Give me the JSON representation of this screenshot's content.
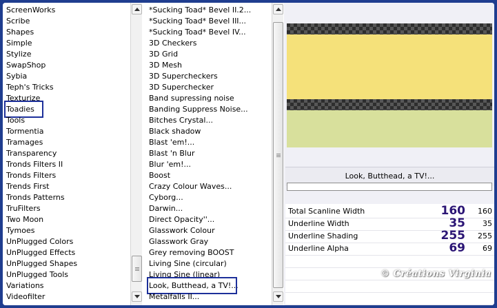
{
  "categories": {
    "items": [
      "ScreenWorks",
      "Scribe",
      "Shapes",
      "Simple",
      "Stylize",
      "SwapShop",
      "Sybia",
      "Teph's Tricks",
      "Texturize",
      "Toadies",
      "Tools",
      "Tormentia",
      "Tramages",
      "Transparency",
      "Tronds Filters II",
      "Tronds Filters",
      "Trends First",
      "Tronds Patterns",
      "TruFilters",
      "Two Moon",
      "Tymoes",
      "UnPlugged Colors",
      "UnPlugged Effects",
      "UnPlugged Shapes",
      "UnPlugged Tools",
      "Variations",
      "Videofilter"
    ],
    "selected": "Toadies"
  },
  "filters": {
    "items": [
      "*Sucking Toad* Bevel II.2...",
      "*Sucking Toad* Bevel III...",
      "*Sucking Toad* Bevel IV...",
      "3D Checkers",
      "3D Grid",
      "3D Mesh",
      "3D Supercheckers",
      "3D Superchecker",
      "Band supressing noise",
      "Banding Suppress Noise...",
      "Bitches Crystal...",
      "Black shadow",
      "Blast 'em!...",
      "Blast 'n Blur",
      "Blur 'em!...",
      "Boost",
      "Crazy Colour Waves...",
      "Cyborg...",
      "Darwin...",
      "Direct Opacity''...",
      "Glasswork Colour",
      "Glasswork Gray",
      "Grey removing BOOST",
      "Living Sine (circular)",
      "Living Sine (linear)",
      "Look, Butthead, a TV!...",
      "Metalfalls II..."
    ],
    "selected": "Look, Butthead, a TV!..."
  },
  "preview": {
    "colors": {
      "top_checker": "#2e2e2e",
      "yellow": "#f5e17a",
      "green": "#d8e09c"
    }
  },
  "filter_name": "Look, Butthead, a TV!...",
  "params": [
    {
      "label": "Total Scanline Width",
      "big": "160",
      "small": "160"
    },
    {
      "label": "Underline Width",
      "big": "35",
      "small": "35"
    },
    {
      "label": "Underline Shading",
      "big": "255",
      "small": "255"
    },
    {
      "label": "Underline Alpha",
      "big": "69",
      "small": "69"
    }
  ],
  "watermark": "© Créations Virginia",
  "colors": {
    "frame": "#1f3d8f",
    "selection_border": "#1c2f9a",
    "value": "#2b1575"
  }
}
